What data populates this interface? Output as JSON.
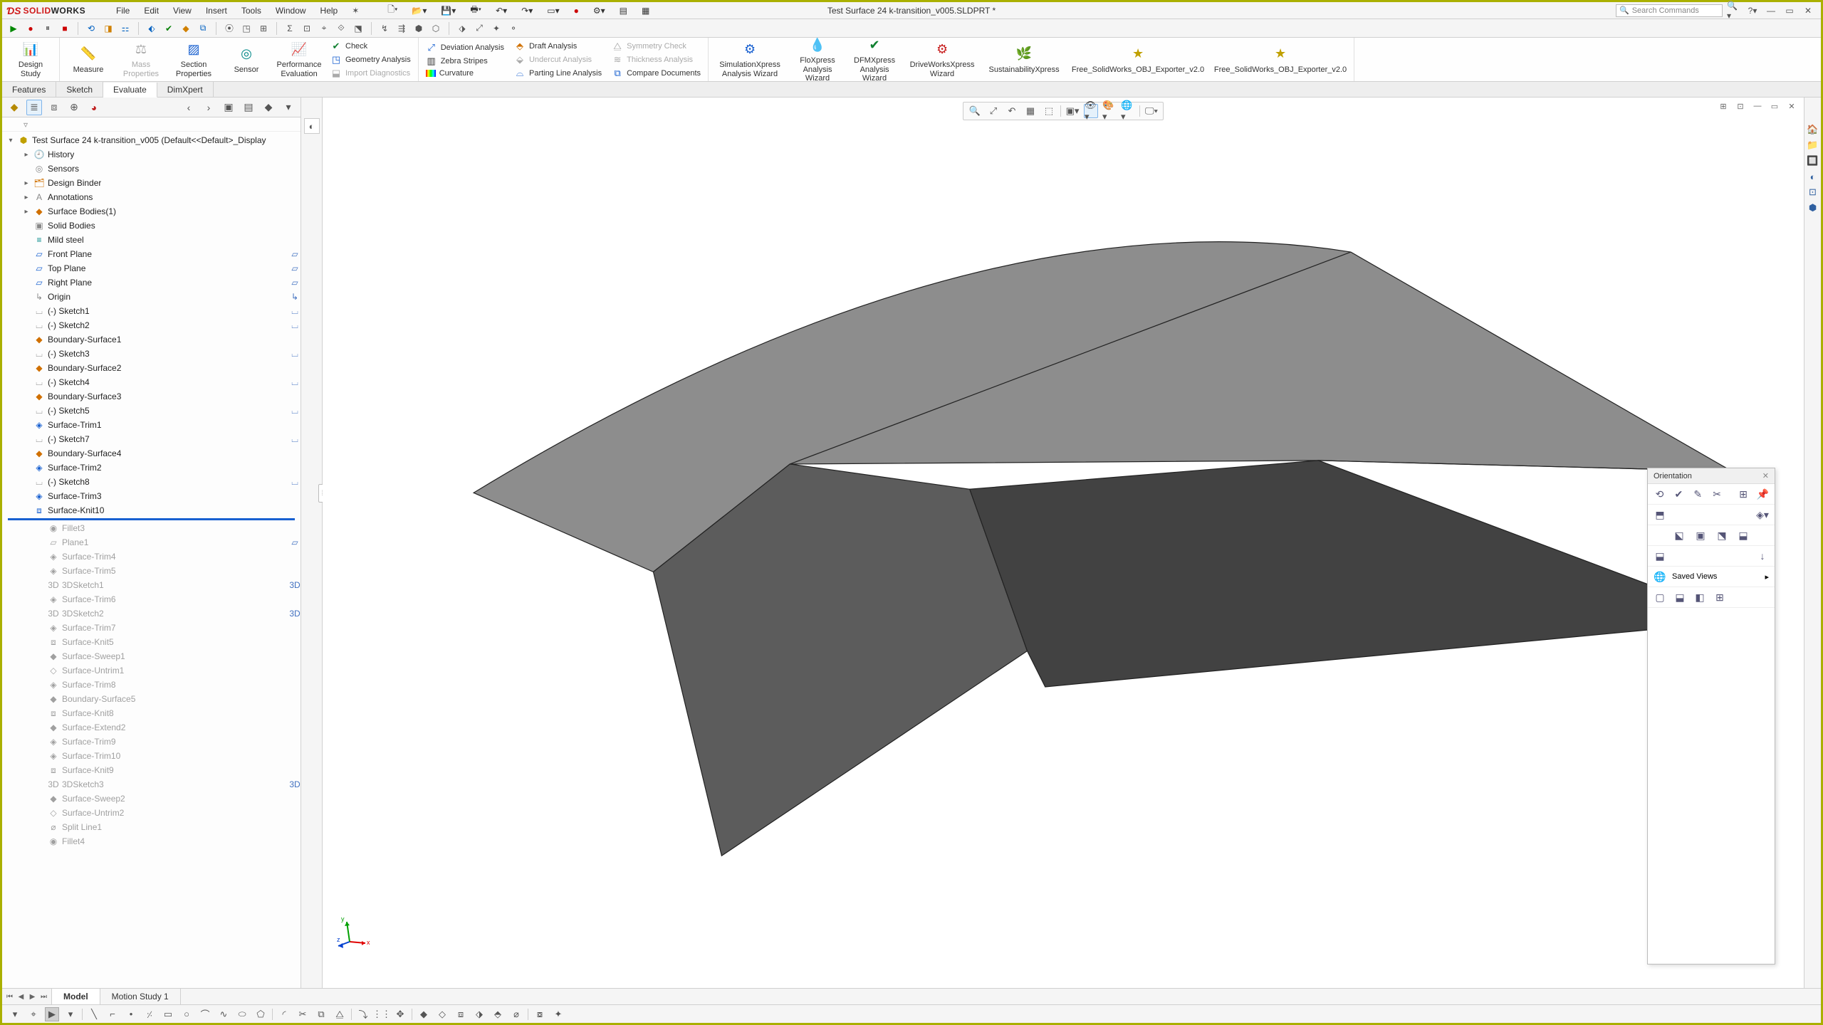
{
  "title": "Test Surface 24 k-transition_v005.SLDPRT *",
  "logo": {
    "brand1": "SOLID",
    "brand2": "WORKS"
  },
  "menubar": [
    "File",
    "Edit",
    "View",
    "Insert",
    "Tools",
    "Window",
    "Help"
  ],
  "search_placeholder": "Search Commands",
  "ribbon": {
    "design_study": "Design\nStudy",
    "measure": "Measure",
    "mass_properties": "Mass\nProperties",
    "section_properties": "Section\nProperties",
    "sensor": "Sensor",
    "performance_evaluation": "Performance\nEvaluation",
    "check": "Check",
    "geometry_analysis": "Geometry Analysis",
    "import_diagnostics": "Import Diagnostics",
    "deviation_analysis": "Deviation Analysis",
    "zebra_stripes": "Zebra Stripes",
    "curvature": "Curvature",
    "draft_analysis": "Draft Analysis",
    "undercut_analysis": "Undercut Analysis",
    "parting_line_analysis": "Parting Line Analysis",
    "symmetry_check": "Symmetry Check",
    "thickness_analysis": "Thickness Analysis",
    "compare_documents": "Compare Documents",
    "simxpress": "SimulationXpress\nAnalysis Wizard",
    "floxpress": "FloXpress\nAnalysis\nWizard",
    "dfmxpress": "DFMXpress\nAnalysis\nWizard",
    "driveworks": "DriveWorksXpress\nWizard",
    "sustainability": "SustainabilityXpress",
    "obj1": "Free_SolidWorks_OBJ_Exporter_v2.0",
    "obj2": "Free_SolidWorks_OBJ_Exporter_v2.0"
  },
  "cm_tabs": [
    "Features",
    "Sketch",
    "Evaluate",
    "DimXpert"
  ],
  "cm_active": 2,
  "tree_root": "Test Surface 24 k-transition_v005  (Default<<Default>_Display",
  "tree": [
    {
      "label": "History",
      "indent": 1,
      "exp": "▸",
      "ico": "🕘",
      "c": "c-blue"
    },
    {
      "label": "Sensors",
      "indent": 1,
      "exp": "",
      "ico": "◎",
      "c": "c-gray"
    },
    {
      "label": "Design Binder",
      "indent": 1,
      "exp": "▸",
      "ico": "🗂",
      "c": "c-orange"
    },
    {
      "label": "Annotations",
      "indent": 1,
      "exp": "▸",
      "ico": "A",
      "c": "c-gray"
    },
    {
      "label": "Surface Bodies(1)",
      "indent": 1,
      "exp": "▸",
      "ico": "◆",
      "c": "c-orange"
    },
    {
      "label": "Solid Bodies",
      "indent": 1,
      "exp": "",
      "ico": "▣",
      "c": "c-gray"
    },
    {
      "label": "Mild steel",
      "indent": 1,
      "exp": "",
      "ico": "≡",
      "c": "c-teal"
    },
    {
      "label": "Front Plane",
      "indent": 1,
      "exp": "",
      "ico": "▱",
      "c": "c-blue",
      "r": "▱"
    },
    {
      "label": "Top Plane",
      "indent": 1,
      "exp": "",
      "ico": "▱",
      "c": "c-blue",
      "r": "▱"
    },
    {
      "label": "Right Plane",
      "indent": 1,
      "exp": "",
      "ico": "▱",
      "c": "c-blue",
      "r": "▱"
    },
    {
      "label": "Origin",
      "indent": 1,
      "exp": "",
      "ico": "↳",
      "c": "c-gray",
      "r": "↳"
    },
    {
      "label": "(-) Sketch1",
      "indent": 1,
      "exp": "",
      "ico": "⌴",
      "c": "c-gray",
      "r": "⌴"
    },
    {
      "label": "(-) Sketch2",
      "indent": 1,
      "exp": "",
      "ico": "⌴",
      "c": "c-gray",
      "r": "⌴"
    },
    {
      "label": "Boundary-Surface1",
      "indent": 1,
      "exp": "",
      "ico": "◆",
      "c": "c-orange"
    },
    {
      "label": "(-) Sketch3",
      "indent": 1,
      "exp": "",
      "ico": "⌴",
      "c": "c-gray",
      "r": "⌴"
    },
    {
      "label": "Boundary-Surface2",
      "indent": 1,
      "exp": "",
      "ico": "◆",
      "c": "c-orange"
    },
    {
      "label": "(-) Sketch4",
      "indent": 1,
      "exp": "",
      "ico": "⌴",
      "c": "c-gray",
      "r": "⌴"
    },
    {
      "label": "Boundary-Surface3",
      "indent": 1,
      "exp": "",
      "ico": "◆",
      "c": "c-orange"
    },
    {
      "label": "(-) Sketch5",
      "indent": 1,
      "exp": "",
      "ico": "⌴",
      "c": "c-gray",
      "r": "⌴"
    },
    {
      "label": "Surface-Trim1",
      "indent": 1,
      "exp": "",
      "ico": "◈",
      "c": "c-blue"
    },
    {
      "label": "(-) Sketch7",
      "indent": 1,
      "exp": "",
      "ico": "⌴",
      "c": "c-gray",
      "r": "⌴"
    },
    {
      "label": "Boundary-Surface4",
      "indent": 1,
      "exp": "",
      "ico": "◆",
      "c": "c-orange"
    },
    {
      "label": "Surface-Trim2",
      "indent": 1,
      "exp": "",
      "ico": "◈",
      "c": "c-blue"
    },
    {
      "label": "(-) Sketch8",
      "indent": 1,
      "exp": "",
      "ico": "⌴",
      "c": "c-gray",
      "r": "⌴"
    },
    {
      "label": "Surface-Trim3",
      "indent": 1,
      "exp": "",
      "ico": "◈",
      "c": "c-blue"
    },
    {
      "label": "Surface-Knit10",
      "indent": 1,
      "exp": "",
      "ico": "⧈",
      "c": "c-blue"
    }
  ],
  "tree_suppressed": [
    {
      "label": "Fillet3",
      "ico": "◉"
    },
    {
      "label": "Plane1",
      "ico": "▱",
      "r": "▱"
    },
    {
      "label": "Surface-Trim4",
      "ico": "◈"
    },
    {
      "label": "Surface-Trim5",
      "ico": "◈"
    },
    {
      "label": "3DSketch1",
      "ico": "3D",
      "r": "3D"
    },
    {
      "label": "Surface-Trim6",
      "ico": "◈"
    },
    {
      "label": "3DSketch2",
      "ico": "3D",
      "r": "3D"
    },
    {
      "label": "Surface-Trim7",
      "ico": "◈"
    },
    {
      "label": "Surface-Knit5",
      "ico": "⧈"
    },
    {
      "label": "Surface-Sweep1",
      "ico": "◆"
    },
    {
      "label": "Surface-Untrim1",
      "ico": "◇"
    },
    {
      "label": "Surface-Trim8",
      "ico": "◈"
    },
    {
      "label": "Boundary-Surface5",
      "ico": "◆"
    },
    {
      "label": "Surface-Knit8",
      "ico": "⧈"
    },
    {
      "label": "Surface-Extend2",
      "ico": "◆"
    },
    {
      "label": "Surface-Trim9",
      "ico": "◈"
    },
    {
      "label": "Surface-Trim10",
      "ico": "◈"
    },
    {
      "label": "Surface-Knit9",
      "ico": "⧈"
    },
    {
      "label": "3DSketch3",
      "ico": "3D",
      "r": "3D"
    },
    {
      "label": "Surface-Sweep2",
      "ico": "◆"
    },
    {
      "label": "Surface-Untrim2",
      "ico": "◇"
    },
    {
      "label": "Split Line1",
      "ico": "⌀"
    },
    {
      "label": "Fillet4",
      "ico": "◉"
    }
  ],
  "orientation": {
    "title": "Orientation",
    "saved_views": "Saved Views"
  },
  "bottom_tabs": [
    "Model",
    "Motion Study 1"
  ],
  "bottom_active": 0
}
